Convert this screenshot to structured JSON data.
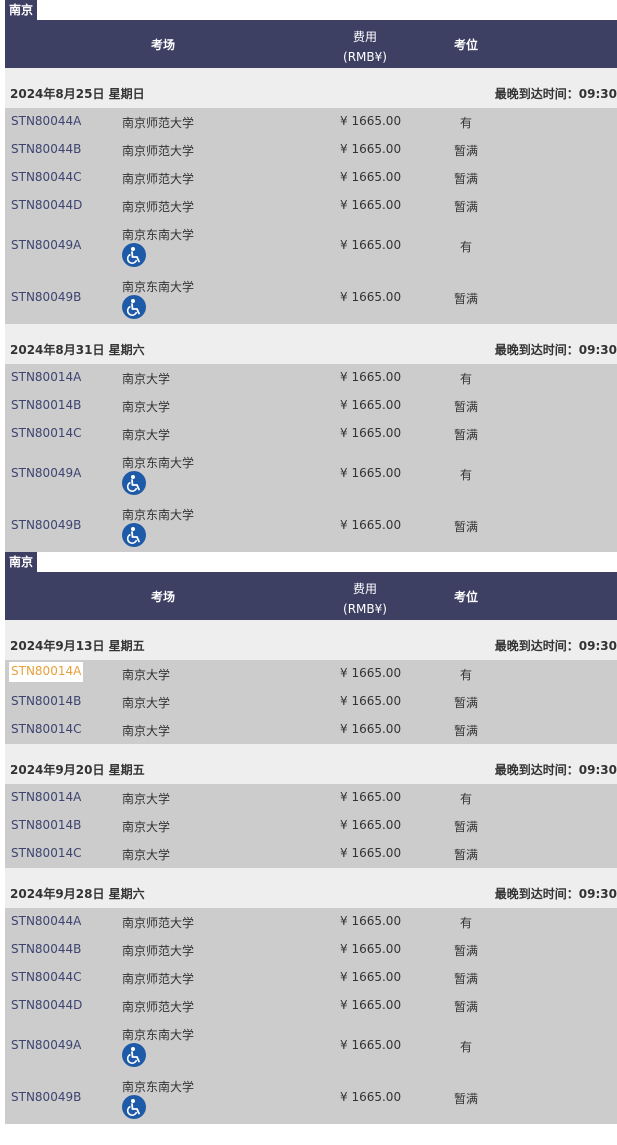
{
  "header": {
    "venue_label": "考场",
    "fee_label_line1": "费用",
    "fee_label_line2": "(RMB¥)",
    "seat_label": "考位"
  },
  "sections": [
    {
      "city": "南京",
      "dates": [
        {
          "date": "2024年8月25日 星期日",
          "arrival": "最晚到达时间：09:30",
          "rows": [
            {
              "code": "STN80044A",
              "venue": "南京师范大学",
              "fee": "¥ 1665.00",
              "seat": "有",
              "accessible": false
            },
            {
              "code": "STN80044B",
              "venue": "南京师范大学",
              "fee": "¥ 1665.00",
              "seat": "暂满",
              "accessible": false
            },
            {
              "code": "STN80044C",
              "venue": "南京师范大学",
              "fee": "¥ 1665.00",
              "seat": "暂满",
              "accessible": false
            },
            {
              "code": "STN80044D",
              "venue": "南京师范大学",
              "fee": "¥ 1665.00",
              "seat": "暂满",
              "accessible": false
            },
            {
              "code": "STN80049A",
              "venue": "南京东南大学",
              "fee": "¥ 1665.00",
              "seat": "有",
              "accessible": true
            },
            {
              "code": "STN80049B",
              "venue": "南京东南大学",
              "fee": "¥ 1665.00",
              "seat": "暂满",
              "accessible": true
            }
          ]
        },
        {
          "date": "2024年8月31日 星期六",
          "arrival": "最晚到达时间：09:30",
          "rows": [
            {
              "code": "STN80014A",
              "venue": "南京大学",
              "fee": "¥ 1665.00",
              "seat": "有",
              "accessible": false
            },
            {
              "code": "STN80014B",
              "venue": "南京大学",
              "fee": "¥ 1665.00",
              "seat": "暂满",
              "accessible": false
            },
            {
              "code": "STN80014C",
              "venue": "南京大学",
              "fee": "¥ 1665.00",
              "seat": "暂满",
              "accessible": false
            },
            {
              "code": "STN80049A",
              "venue": "南京东南大学",
              "fee": "¥ 1665.00",
              "seat": "有",
              "accessible": true
            },
            {
              "code": "STN80049B",
              "venue": "南京东南大学",
              "fee": "¥ 1665.00",
              "seat": "暂满",
              "accessible": true
            }
          ]
        }
      ]
    },
    {
      "city": "南京",
      "dates": [
        {
          "date": "2024年9月13日 星期五",
          "arrival": "最晚到达时间：09:30",
          "rows": [
            {
              "code": "STN80014A",
              "venue": "南京大学",
              "fee": "¥ 1665.00",
              "seat": "有",
              "accessible": false,
              "active": true
            },
            {
              "code": "STN80014B",
              "venue": "南京大学",
              "fee": "¥ 1665.00",
              "seat": "暂满",
              "accessible": false
            },
            {
              "code": "STN80014C",
              "venue": "南京大学",
              "fee": "¥ 1665.00",
              "seat": "暂满",
              "accessible": false
            }
          ]
        },
        {
          "date": "2024年9月20日 星期五",
          "arrival": "最晚到达时间：09:30",
          "rows": [
            {
              "code": "STN80014A",
              "venue": "南京大学",
              "fee": "¥ 1665.00",
              "seat": "有",
              "accessible": false
            },
            {
              "code": "STN80014B",
              "venue": "南京大学",
              "fee": "¥ 1665.00",
              "seat": "暂满",
              "accessible": false
            },
            {
              "code": "STN80014C",
              "venue": "南京大学",
              "fee": "¥ 1665.00",
              "seat": "暂满",
              "accessible": false
            }
          ]
        },
        {
          "date": "2024年9月28日 星期六",
          "arrival": "最晚到达时间：09:30",
          "rows": [
            {
              "code": "STN80044A",
              "venue": "南京师范大学",
              "fee": "¥ 1665.00",
              "seat": "有",
              "accessible": false
            },
            {
              "code": "STN80044B",
              "venue": "南京师范大学",
              "fee": "¥ 1665.00",
              "seat": "暂满",
              "accessible": false
            },
            {
              "code": "STN80044C",
              "venue": "南京师范大学",
              "fee": "¥ 1665.00",
              "seat": "暂满",
              "accessible": false
            },
            {
              "code": "STN80044D",
              "venue": "南京师范大学",
              "fee": "¥ 1665.00",
              "seat": "暂满",
              "accessible": false
            },
            {
              "code": "STN80049A",
              "venue": "南京东南大学",
              "fee": "¥ 1665.00",
              "seat": "有",
              "accessible": true
            },
            {
              "code": "STN80049B",
              "venue": "南京东南大学",
              "fee": "¥ 1665.00",
              "seat": "暂满",
              "accessible": true
            }
          ]
        }
      ]
    }
  ],
  "colors": {
    "header_bg": "#3d3f63",
    "date_bg": "#eeeeee",
    "row_bg": "#cccccc",
    "link": "#3d4470",
    "active_link": "#e8a03a",
    "accessible_icon": "#1d5aa8"
  },
  "icons": {
    "accessible": "wheelchair-icon"
  }
}
